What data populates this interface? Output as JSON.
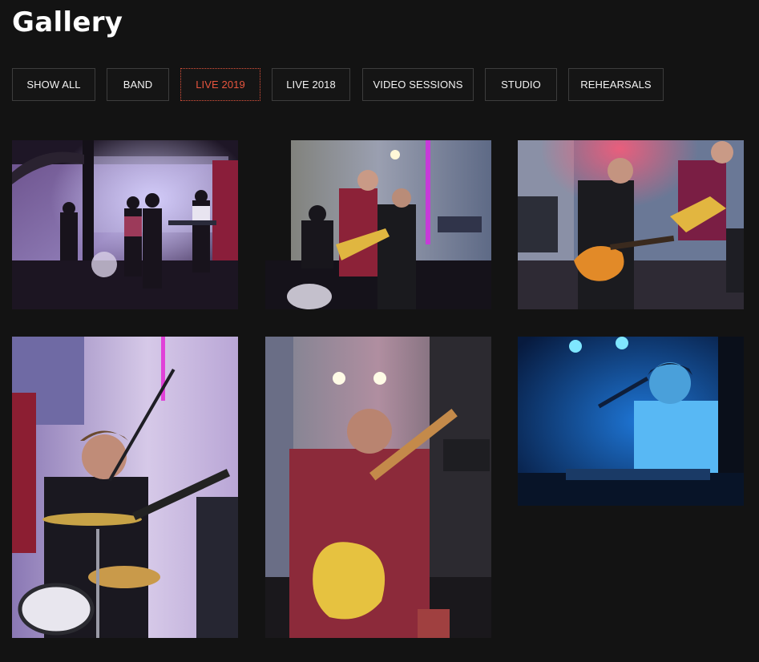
{
  "page": {
    "title": "Gallery"
  },
  "filters": [
    {
      "label": "SHOW ALL"
    },
    {
      "label": "BAND"
    },
    {
      "label": "LIVE 2019",
      "active": true
    },
    {
      "label": "LIVE 2018"
    },
    {
      "label": "VIDEO SESSIONS"
    },
    {
      "label": "STUDIO"
    },
    {
      "label": "REHEARSALS"
    }
  ],
  "colors": {
    "background": "#131313",
    "accent": "#e8553e",
    "button_border": "#3d3d3d",
    "text": "#ffffff"
  }
}
